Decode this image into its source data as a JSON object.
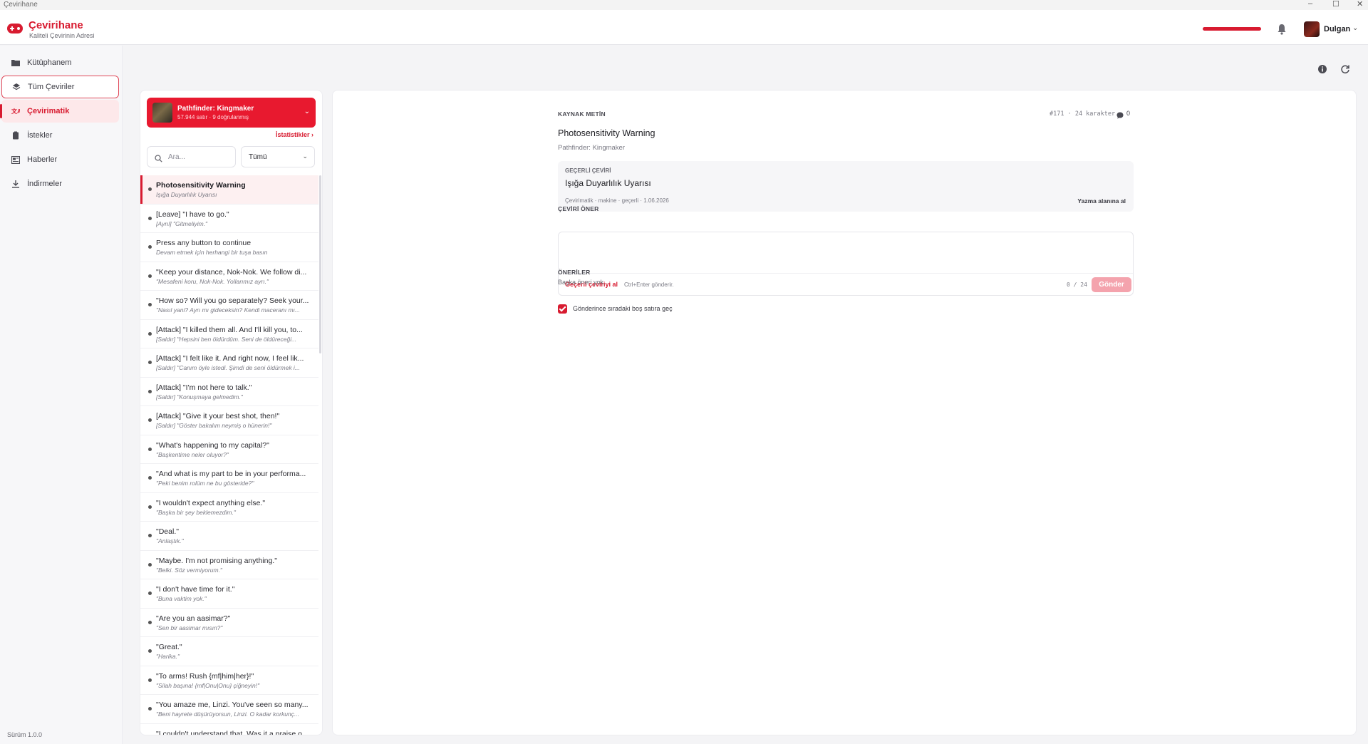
{
  "window": {
    "title": "Çevirihane",
    "controls": [
      "–",
      "☐",
      "✕"
    ]
  },
  "header": {
    "brand": "Çevirihane",
    "tagline": "Kaliteli Çevirinin Adresi",
    "progress_fraction": 1.0,
    "username": "Dulgan"
  },
  "sidebar": {
    "items": [
      {
        "label": "Kütüphanem",
        "icon": "folder-icon"
      },
      {
        "label": "Tüm Çeviriler",
        "icon": "layers-icon"
      },
      {
        "label": "Çevirimatik",
        "icon": "translate-icon"
      },
      {
        "label": "İstekler",
        "icon": "clipboard-icon"
      },
      {
        "label": "Haberler",
        "icon": "newspaper-icon"
      },
      {
        "label": "İndirmeler",
        "icon": "download-icon"
      }
    ],
    "version": "Sürüm 1.0.0"
  },
  "list": {
    "game": {
      "title": "Pathfinder: Kingmaker",
      "subtitle": "57.944 satır · 9 doğrulanmış"
    },
    "stats_link": "İstatistikler ›",
    "search_placeholder": "Ara...",
    "filter_value": "Tümü",
    "rows": [
      {
        "src": "Photosensitivity Warning",
        "trn": "Işığa Duyarlılık Uyarısı"
      },
      {
        "src": "[Leave] \"I have to go.\"",
        "trn": "[Ayrıl] \"Gitmeliyim.\""
      },
      {
        "src": "Press any button to continue",
        "trn": "Devam etmek için herhangi bir tuşa basın"
      },
      {
        "src": "\"Keep your distance, Nok-Nok. We follow di...",
        "trn": "\"Mesafeni koru, Nok-Nok. Yollarımız ayrı.\""
      },
      {
        "src": "\"How so? Will you go separately? Seek your...",
        "trn": "\"Nasıl yani? Ayrı mı gideceksin? Kendi maceranı mı..."
      },
      {
        "src": "[Attack] \"I killed them all. And I'll kill you, to...",
        "trn": "[Saldır] \"Hepsini ben öldürdüm. Seni de öldüreceği..."
      },
      {
        "src": "[Attack] \"I felt like it. And right now, I feel lik...",
        "trn": "[Saldır] \"Canım öyle istedi. Şimdi de seni öldürmek i..."
      },
      {
        "src": "[Attack] \"I'm not here to talk.\"",
        "trn": "[Saldır] \"Konuşmaya gelmedim.\""
      },
      {
        "src": "[Attack] \"Give it your best shot, then!\"",
        "trn": "[Saldır] \"Göster bakalım neymiş o hünerin!\""
      },
      {
        "src": "\"What's happening to my capital?\"",
        "trn": "\"Başkentime neler oluyor?\""
      },
      {
        "src": "\"And what is my part to be in your performa...",
        "trn": "\"Peki benim rolüm ne bu gösteride?\""
      },
      {
        "src": "\"I wouldn't expect anything else.\"",
        "trn": "\"Başka bir şey beklemezdim.\""
      },
      {
        "src": "\"Deal.\"",
        "trn": "\"Anlaştık.\""
      },
      {
        "src": "\"Maybe. I'm not promising anything.\"",
        "trn": "\"Belki. Söz vermiyorum.\""
      },
      {
        "src": "\"I don't have time for it.\"",
        "trn": "\"Buna vaktim yok.\""
      },
      {
        "src": "\"Are you an aasimar?\"",
        "trn": "\"Sen bir aasimar mısın?\""
      },
      {
        "src": "\"Great.\"",
        "trn": "\"Harika.\""
      },
      {
        "src": "\"To arms! Rush {mf|him|her}!\"",
        "trn": "\"Silah başına! {mf|Onu|Onu} çiğneyin!\""
      },
      {
        "src": "\"You amaze me, Linzi. You've seen so many...",
        "trn": "\"Beni hayrete düşürüyorsun, Linzi. O kadar korkunç..."
      },
      {
        "src": "\"I couldn't understand that. Was it a praise o...",
        "trn": ""
      }
    ]
  },
  "detail": {
    "source_label": "KAYNAK METİN",
    "meta": "#171 · 24 karakter",
    "comment_count": "0",
    "source_text": "Photosensitivity Warning",
    "game_name": "Pathfinder: Kingmaker",
    "current": {
      "label": "GEÇERLİ ÇEVİRİ",
      "text": "Işığa Duyarlılık Uyarısı",
      "meta": "Çevirimatik · makine · geçerli · 1.06.2026",
      "action": "Yazma alanına al"
    },
    "suggest": {
      "label": "ÇEVİRİ ÖNER",
      "use_current": "Geçerli çeviriyi al",
      "hint": "Ctrl+Enter gönderir.",
      "char_count": "0 / 24",
      "send": "Gönder"
    },
    "checkbox_label": "Gönderince sıradaki boş satıra geç",
    "suggestions_label": "ÖNERİLER",
    "no_suggestions": "Başka öneri yok."
  }
}
